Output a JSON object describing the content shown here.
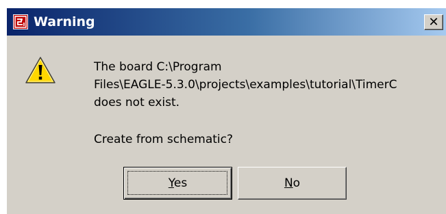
{
  "window": {
    "title": "Warning",
    "close_glyph": "✕",
    "app_icon": "eagle-app-icon"
  },
  "message": {
    "icon": "warning-icon",
    "line1": "The board C:\\Program",
    "line2": "Files\\EAGLE-5.3.0\\projects\\examples\\tutorial\\TimerC",
    "line3": "does not exist.",
    "question": "Create from schematic?"
  },
  "buttons": {
    "yes": {
      "accel": "Y",
      "rest": "es"
    },
    "no": {
      "accel": "N",
      "rest": "o"
    }
  },
  "colors": {
    "title_bar_start": "#0a246a",
    "title_bar_end": "#a6caf0",
    "dialog_face": "#d4d0c8",
    "warning_yellow": "#ffd700"
  }
}
